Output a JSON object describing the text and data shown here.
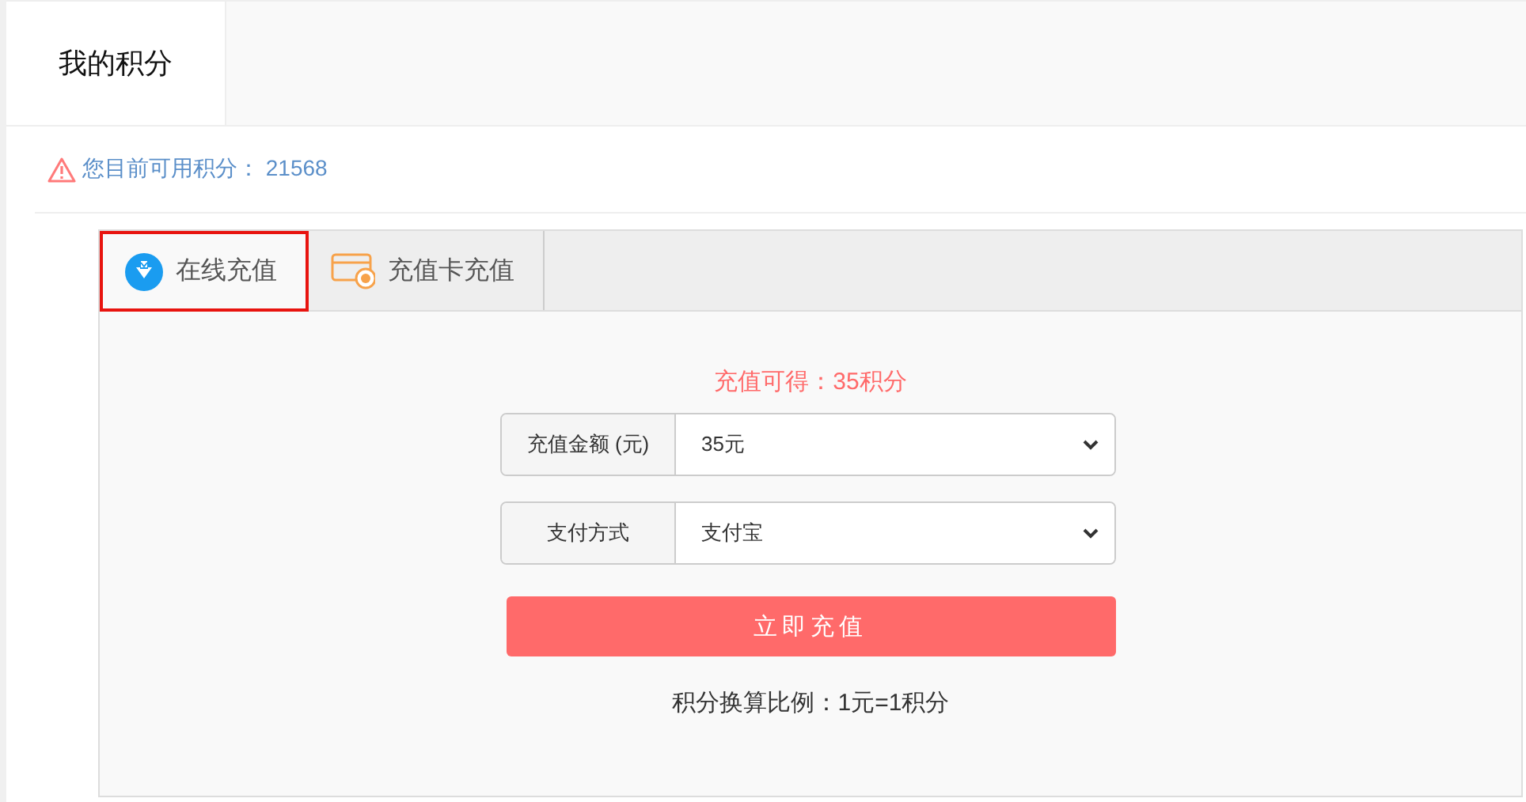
{
  "page_tabs": [
    {
      "label": "我的积分",
      "selected": true
    }
  ],
  "notice": {
    "label": "您目前可用积分：",
    "value": "21568"
  },
  "recharge_tabs": [
    {
      "label": "在线充值",
      "kind": "coin",
      "selected": true
    },
    {
      "label": "充值卡充值",
      "kind": "card",
      "selected": false
    }
  ],
  "bonus_text": "充值可得：35积分",
  "fields": [
    {
      "label": "充值金额 (元)",
      "value": "35元"
    },
    {
      "label": "支付方式",
      "value": "支付宝"
    }
  ],
  "submit_button": "立即充值",
  "ratio_text": "积分换算比例：1元=1积分"
}
